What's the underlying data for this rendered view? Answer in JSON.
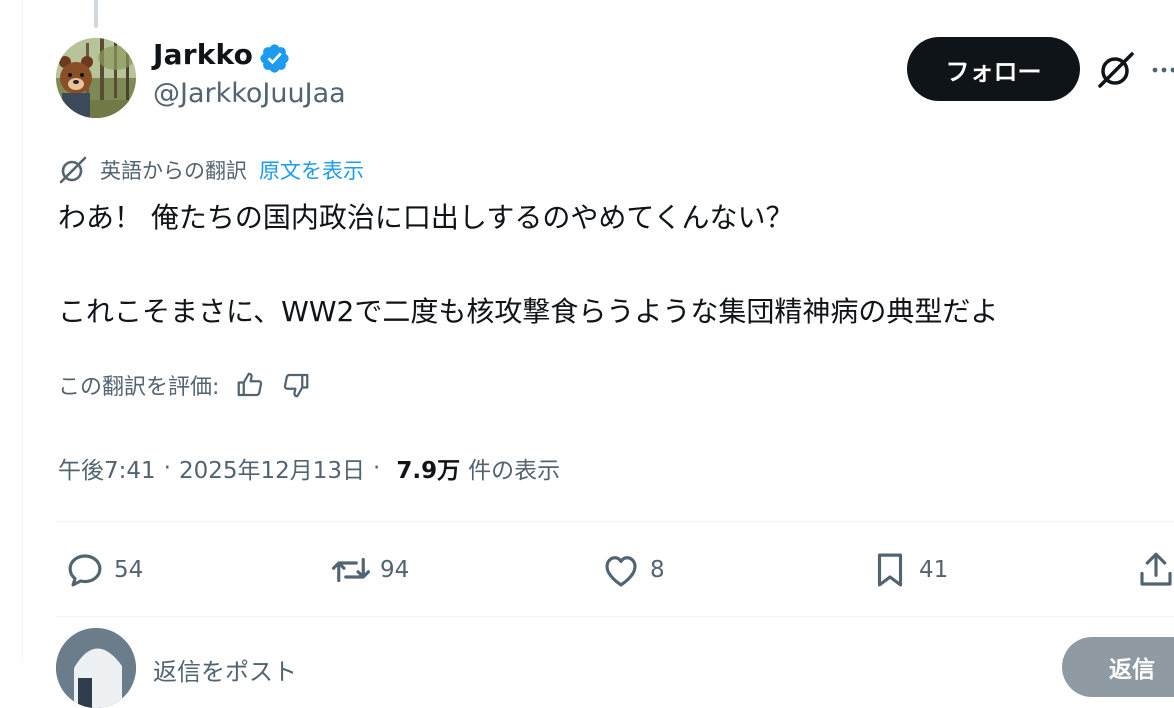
{
  "author": {
    "name": "Jarkko",
    "handle": "@JarkkoJuuJaa",
    "verified": true
  },
  "header": {
    "follow_label": "フォロー"
  },
  "translation": {
    "source_label": "英語からの翻訳",
    "show_original_label": "原文を表示"
  },
  "tweet": {
    "line1": "わあ！ 俺たちの国内政治に口出しするのやめてくんない？",
    "line2": "これこそまさに、WW2で二度も核攻撃食らうような集団精神病の典型だよ"
  },
  "rating": {
    "label": "この翻訳を評価:"
  },
  "meta": {
    "time": "午後7:41",
    "separator": "·",
    "date": "2025年12月13日",
    "views": "7.9万",
    "views_label": "件の表示"
  },
  "actions": {
    "replies": "54",
    "reposts": "94",
    "likes": "8",
    "bookmarks": "41"
  },
  "reply_box": {
    "placeholder": "返信をポスト",
    "button_label": "返信"
  },
  "colors": {
    "accent": "#1d9bf0",
    "text_primary": "#0f1419",
    "text_secondary": "#536471",
    "divider": "#eff3f4"
  }
}
